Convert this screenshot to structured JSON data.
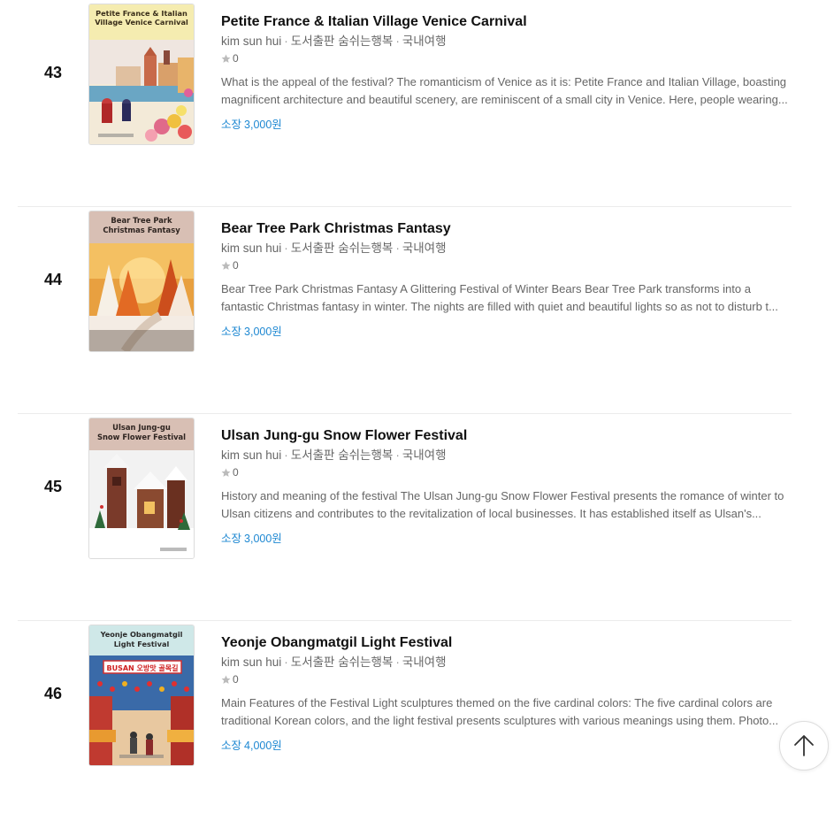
{
  "books": [
    {
      "rank": "43",
      "title": "Petite France & Italian Village Venice Carnival",
      "author": "kim sun hui",
      "publisher": "도서출판 숨쉬는행복",
      "category": "국내여행",
      "rating": "0",
      "description": "What is the appeal of the festival? The romanticism of Venice as it is: Petite France and Italian Village, boasting magnificent architecture and beautiful scenery, are reminiscent of a small city in Venice. Here, people wearing...",
      "price_label": "소장",
      "price": "3,000원",
      "cover_title_line1": "Petite France & Italian",
      "cover_title_line2": "Village Venice Carnival",
      "cover_bg": "#f5ecb0"
    },
    {
      "rank": "44",
      "title": "Bear Tree Park Christmas Fantasy",
      "author": "kim sun hui",
      "publisher": "도서출판 숨쉬는행복",
      "category": "국내여행",
      "rating": "0",
      "description": "Bear Tree Park Christmas Fantasy A Glittering Festival of Winter Bears Bear Tree Park transforms into a fantastic Christmas fantasy in winter. The nights are filled with quiet and beautiful lights so as not to disturb t...",
      "price_label": "소장",
      "price": "3,000원",
      "cover_title_line1": "Bear Tree Park",
      "cover_title_line2": "Christmas Fantasy",
      "cover_bg": "#d8bfb4"
    },
    {
      "rank": "45",
      "title": "Ulsan Jung-gu Snow Flower Festival",
      "author": "kim sun hui",
      "publisher": "도서출판 숨쉬는행복",
      "category": "국내여행",
      "rating": "0",
      "description": "History and meaning of the festival The Ulsan Jung-gu Snow Flower Festival presents the romance of winter to Ulsan citizens and contributes to the revitalization of local businesses. It has established itself as Ulsan's...",
      "price_label": "소장",
      "price": "3,000원",
      "cover_title_line1": "Ulsan Jung-gu",
      "cover_title_line2": "Snow Flower Festival",
      "cover_bg": "#d8bfb4"
    },
    {
      "rank": "46",
      "title": "Yeonje Obangmatgil Light Festival",
      "author": "kim sun hui",
      "publisher": "도서출판 숨쉬는행복",
      "category": "국내여행",
      "rating": "0",
      "description": "Main Features of the Festival Light sculptures themed on the five cardinal colors: The five cardinal colors are traditional Korean colors, and the light festival presents sculptures with various meanings using them. Photo...",
      "price_label": "소장",
      "price": "4,000원",
      "cover_title_line1": "Yeonje Obangmatgil",
      "cover_title_line2": "Light Festival",
      "cover_bg": "#cfe8e8",
      "cover_banner_text": "BUSAN 오방맛 골목길"
    }
  ],
  "colors": {
    "accent_price": "#1e88d2",
    "divider": "#ececec",
    "star": "#bbbbbb"
  },
  "icons": {
    "rating": "star-icon",
    "scroll_top": "arrow-up-icon"
  }
}
